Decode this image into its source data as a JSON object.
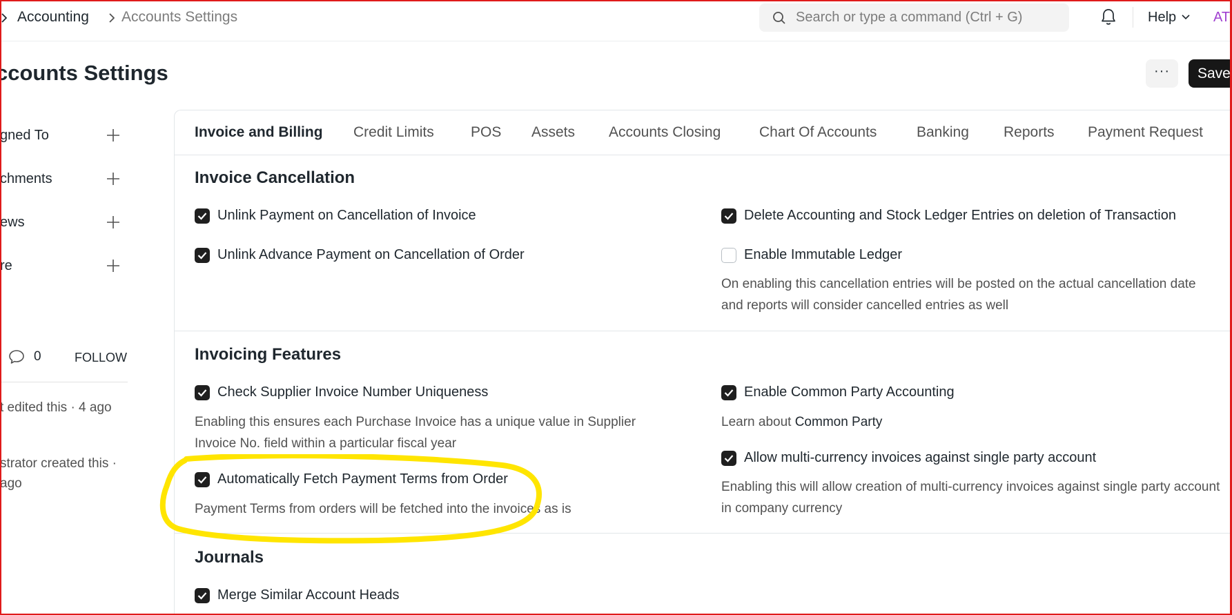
{
  "breadcrumb": {
    "items": [
      "Accounting",
      "Accounts Settings"
    ]
  },
  "search": {
    "placeholder": "Search or type a command (Ctrl + G)"
  },
  "navbar": {
    "help_label": "Help",
    "avatar_text": "AT"
  },
  "page": {
    "title": "ccounts Settings",
    "more_label": "···",
    "save_label": "Save"
  },
  "sidebar": {
    "items": [
      {
        "label": "gned To"
      },
      {
        "label": "chments"
      },
      {
        "label": "ews"
      },
      {
        "label": "re"
      }
    ],
    "comment_count": "0",
    "follow_label": "FOLLOW",
    "activity": [
      {
        "text": "t edited this · 4 ago"
      },
      {
        "text": "strator created this · ago"
      }
    ]
  },
  "tabs": [
    {
      "label": "Invoice and Billing",
      "active": true
    },
    {
      "label": "Credit Limits"
    },
    {
      "label": "POS"
    },
    {
      "label": "Assets"
    },
    {
      "label": "Accounts Closing"
    },
    {
      "label": "Chart Of Accounts"
    },
    {
      "label": "Banking"
    },
    {
      "label": "Reports"
    },
    {
      "label": "Payment Request"
    }
  ],
  "sections": {
    "invoice_cancellation": {
      "title": "Invoice Cancellation",
      "unlink_payment": {
        "label": "Unlink Payment on Cancellation of Invoice",
        "checked": true
      },
      "unlink_advance": {
        "label": "Unlink Advance Payment on Cancellation of Order",
        "checked": true
      },
      "delete_ledger": {
        "label": "Delete Accounting and Stock Ledger Entries on deletion of Transaction",
        "checked": true
      },
      "immutable_ledger": {
        "label": "Enable Immutable Ledger",
        "checked": false
      },
      "immutable_desc": "On enabling this cancellation entries will be posted on the actual cancellation date and reports will consider cancelled entries as well"
    },
    "invoicing_features": {
      "title": "Invoicing Features",
      "supplier_unique": {
        "label": "Check Supplier Invoice Number Uniqueness",
        "checked": true
      },
      "supplier_unique_desc": "Enabling this ensures each Purchase Invoice has a unique value in Supplier Invoice No. field within a particular fiscal year",
      "fetch_terms": {
        "label": "Automatically Fetch Payment Terms from Order",
        "checked": true
      },
      "fetch_terms_desc": "Payment Terms from orders will be fetched into the invoices as is",
      "common_party": {
        "label": "Enable Common Party Accounting",
        "checked": true
      },
      "common_party_desc_prefix": "Learn about ",
      "common_party_link": "Common Party",
      "multi_currency": {
        "label": "Allow multi-currency invoices against single party account",
        "checked": true
      },
      "multi_currency_desc": "Enabling this will allow creation of multi-currency invoices against single party account in company currency"
    },
    "journals": {
      "title": "Journals",
      "merge_heads": {
        "label": "Merge Similar Account Heads",
        "checked": true
      }
    }
  },
  "colors": {
    "frame": "#e01b1b",
    "highlight": "#ffe500",
    "checkbox_on": "#1f1f1f",
    "save_button": "#171717"
  }
}
